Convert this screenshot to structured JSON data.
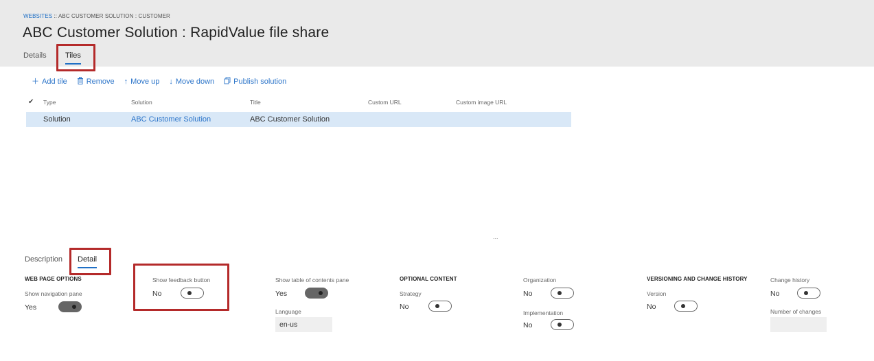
{
  "breadcrumb": {
    "link": "WEBSITES",
    "rest": " :: ABC CUSTOMER SOLUTION : CUSTOMER"
  },
  "page_title": "ABC Customer Solution : RapidValue file share",
  "tabs": [
    {
      "label": "Details",
      "active": false
    },
    {
      "label": "Tiles",
      "active": true
    }
  ],
  "toolbar": {
    "add_tile": "Add tile",
    "remove": "Remove",
    "move_up": "Move up",
    "move_down": "Move down",
    "publish": "Publish solution"
  },
  "grid": {
    "check_glyph": "✔",
    "columns": [
      "Type",
      "Solution",
      "Title",
      "Custom URL",
      "Custom image URL"
    ],
    "rows": [
      {
        "type": "Solution",
        "solution": "ABC Customer Solution",
        "title": "ABC Customer Solution",
        "custom_url": "",
        "custom_image_url": ""
      }
    ]
  },
  "more_indicator": "...",
  "detail_tabs": [
    {
      "label": "Description",
      "active": false
    },
    {
      "label": "Detail",
      "active": true
    }
  ],
  "web_page_options": {
    "heading": "WEB PAGE OPTIONS",
    "show_navigation_pane": {
      "label": "Show navigation pane",
      "value": "Yes",
      "on": true
    },
    "show_feedback_button": {
      "label": "Show feedback button",
      "value": "No",
      "on": false
    },
    "show_toc_pane": {
      "label": "Show table of contents pane",
      "value": "Yes",
      "on": true
    },
    "language": {
      "label": "Language",
      "value": "en-us"
    }
  },
  "optional_content": {
    "heading": "OPTIONAL CONTENT",
    "strategy": {
      "label": "Strategy",
      "value": "No",
      "on": false
    },
    "organization": {
      "label": "Organization",
      "value": "No",
      "on": false
    },
    "implementation": {
      "label": "Implementation",
      "value": "No",
      "on": false
    }
  },
  "versioning": {
    "heading": "VERSIONING AND CHANGE HISTORY",
    "version": {
      "label": "Version",
      "value": "No",
      "on": false
    },
    "change_history": {
      "label": "Change history",
      "value": "No",
      "on": false
    },
    "number_of_changes": {
      "label": "Number of changes",
      "value": ""
    }
  },
  "colors": {
    "accent": "#2b74c9",
    "highlight": "#b42a2a",
    "header_band": "#eaeaea",
    "selected_row": "#d9e8f7"
  }
}
